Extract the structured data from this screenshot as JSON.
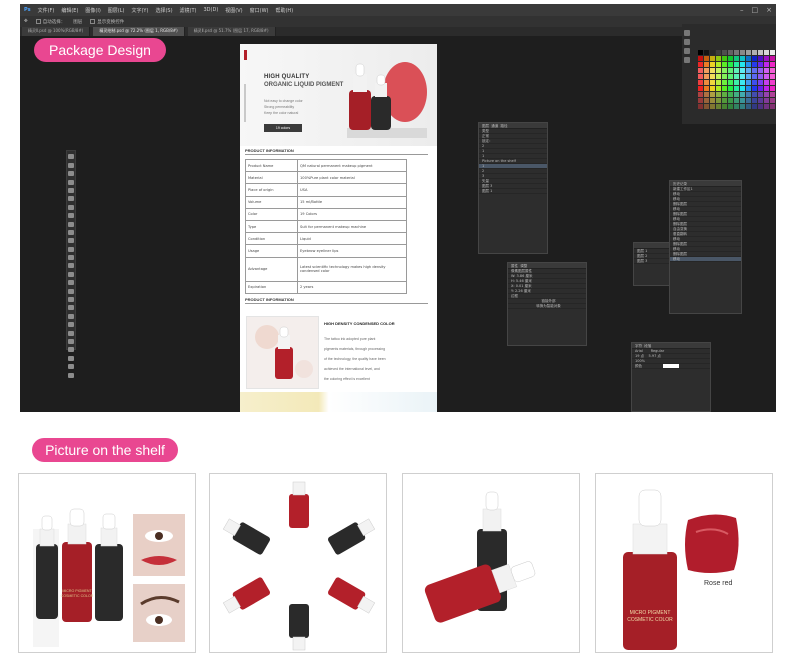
{
  "section_titles": {
    "package": "Package Design",
    "shelf": "Picture on the shelf"
  },
  "colors": {
    "accent_pink": "#e94791",
    "editor_bg": "#1e1e1e",
    "pigment_red": "#b3202a",
    "bottle_black": "#2a2a2a"
  },
  "editor": {
    "app_logo": "Ps",
    "menu": [
      "文件(F)",
      "编辑(E)",
      "图像(I)",
      "图层(L)",
      "文字(Y)",
      "选择(S)",
      "滤镜(T)",
      "3D(D)",
      "视图(V)",
      "窗口(W)",
      "帮助(H)"
    ],
    "window_controls": [
      "–",
      "□",
      "×"
    ],
    "options": {
      "auto_select": "自动选择：",
      "layer_mode": "图层",
      "show_transform": "显示变换控件"
    },
    "tabs": [
      "精灵Ⅱ.psd @ 100%(RGB/8#)",
      "精灵绘制.psd @ 72.2% (图层 1, RGB/8#)",
      "精灵Ⅱ.psd @ 51.7% (图层 17, RGB/8#)"
    ],
    "layers_panel": {
      "tabs": [
        "图层",
        "通道",
        "路径"
      ],
      "rows": [
        "类型",
        "正常",
        "锁定：",
        "2",
        "1",
        "1",
        "Picture on the shelf",
        "1",
        "2",
        "3",
        "矢量",
        "图层 3",
        "图层 1"
      ]
    },
    "history_panel": {
      "title": "历史记录",
      "rows": [
        "新建工作区1",
        "移动",
        "移动",
        "删除图层",
        "移动",
        "删除图层",
        "移动",
        "删除图层",
        "自由变换",
        "垂直翻转",
        "移动",
        "删除图层",
        "移动",
        "删除图层",
        "移动"
      ]
    },
    "properties_panel": {
      "tabs": [
        "属性",
        "调整"
      ],
      "title": "像素图层属性",
      "rows": [
        "W: 3.86 厘米",
        "H: 5.46 厘米",
        "X: 0.01 厘米",
        "Y: 2.26 厘米"
      ],
      "label": "边框",
      "buttons": [
        "链接外部",
        "转换为智能对象"
      ]
    },
    "char_panel": {
      "tabs": [
        "字符",
        "段落"
      ],
      "font": "Arial",
      "style": "Regular",
      "size": "19 点",
      "leading": "5.97 点",
      "tracking": "100%",
      "color_label": "颜色"
    },
    "small_panel": {
      "rows": [
        "图层 1",
        "图层 2",
        "图层 3"
      ]
    }
  },
  "document": {
    "heading_1": "HIGH QUALITY",
    "heading_2": "ORGANIC LIQUID PIGMENT",
    "features": [
      "Not easy to change color",
      "Strong permeability",
      "Keep the color natural"
    ],
    "colors_pill": "19 colors",
    "product_info_header": "PRODUCT INFORMATION",
    "spec_rows": [
      {
        "key": "Product Name",
        "value": "QM natural permanent makeup pigment"
      },
      {
        "key": "Material",
        "value": "100%Pure plant color material"
      },
      {
        "key": "Place of origin",
        "value": "USA"
      },
      {
        "key": "Volume",
        "value": "15 ml/Bottle"
      },
      {
        "key": "Color",
        "value": "19 Colors"
      },
      {
        "key": "Type",
        "value": "Suit for permanent makeup machine"
      },
      {
        "key": "Condition",
        "value": "Liquid"
      },
      {
        "key": "Usage",
        "value": "Eyebrow eyeliner lips"
      },
      {
        "key": "Advantage",
        "value": "Latest scientific technology makes high density condensed color"
      },
      {
        "key": "Expiration",
        "value": "2 years"
      }
    ],
    "product_info_header_2": "PRODUCT INFORMATION",
    "hd_title": "HIGH DENSITY CONDENSED COLOR",
    "hd_lines": [
      "The tattoo ink adopted pure plant",
      "pigments materials, through processing",
      "of the technology, the quality have been",
      "achieved the international level,  and",
      "the coloring effect is excellent"
    ]
  },
  "photos": {
    "bottle_label_line1": "MICRO PIGMENT",
    "bottle_label_line2": "COSMETIC COLOR",
    "swatch_label": "Rose red"
  }
}
